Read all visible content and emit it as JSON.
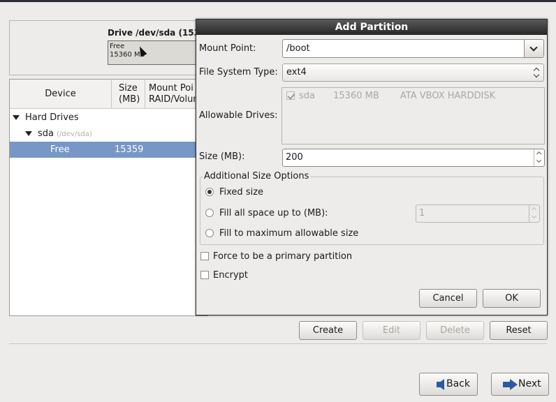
{
  "background": {
    "drive_title": "Drive /dev/sda (153",
    "drive_bar_line1": "Free",
    "drive_bar_line2": "15360 MB",
    "columns": {
      "device": "Device",
      "size_line1": "Size",
      "size_line2": "(MB)",
      "mount_line1": "Mount Poi",
      "mount_line2": "RAID/Volun"
    },
    "tree": {
      "hard_drives": "Hard Drives",
      "sda": "sda",
      "sda_path": "(/dev/sda)",
      "free_device": "Free",
      "free_size": "15359"
    },
    "buttons": {
      "create": "Create",
      "edit": "Edit",
      "delete": "Delete",
      "reset": "Reset"
    },
    "nav": {
      "back": "Back",
      "next": "Next"
    }
  },
  "dialog": {
    "title": "Add Partition",
    "mount_point_label": "Mount Point:",
    "mount_point_value": "/boot",
    "fs_type_label": "File System Type:",
    "fs_type_value": "ext4",
    "allowable_drives_label": "Allowable Drives:",
    "drive_row": {
      "name": "sda",
      "size": "15360 MB",
      "model": "ATA VBOX HARDDISK"
    },
    "size_label": "Size (MB):",
    "size_value": "200",
    "size_options_legend": "Additional Size Options",
    "option_fixed": "Fixed size",
    "option_fill_upto": "Fill all space up to (MB):",
    "fill_upto_value": "1",
    "option_fill_max": "Fill to maximum allowable size",
    "force_primary": "Force to be a primary partition",
    "encrypt": "Encrypt",
    "cancel": "Cancel",
    "ok": "OK"
  }
}
